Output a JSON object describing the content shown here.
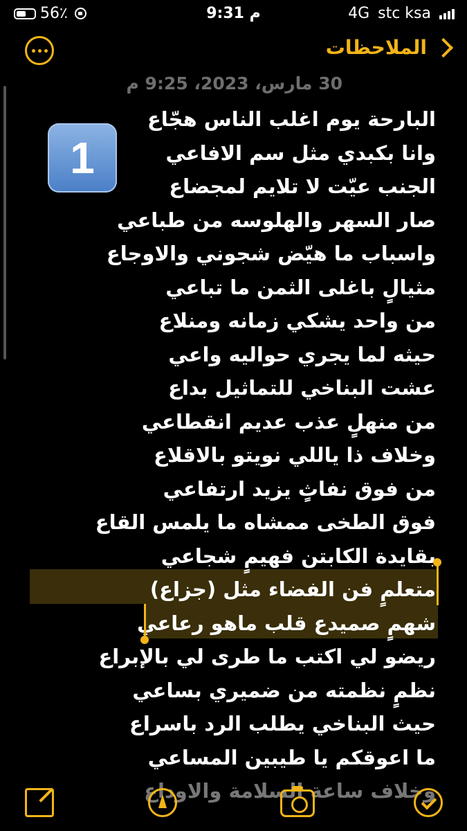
{
  "status_bar": {
    "battery": "56٪",
    "battery_level": 0.56,
    "time": "9:31 م",
    "network": "4G",
    "carrier": "stc ksa"
  },
  "nav": {
    "back_label": "الملاحظات"
  },
  "note": {
    "date": "30 مارس، 2023، 9:25 م",
    "badge": "1",
    "lines": [
      "البارحة يوم اغلب الناس هجّاع",
      "وانا بكبدي مثل سم الافاعي",
      "الجنب عيّت لا تلايم لمجضاع",
      "صار السهر والهلوسه من طباعي",
      "واسباب ما هيّض شجوني والاوجاع",
      "مثيالٍ باغلى الثمن ما تباعي",
      "من واحد يشكي زمانه ومنلاع",
      "حيثه لما يجري حواليه واعي",
      "عشت البناخي للتماثيل بداع",
      "من منهلٍ عذب عديم انقطاعي",
      "وخلاف ذا ياللي نويتو بالاقلاع",
      "من فوق نفاثٍ يزيد ارتفاعي",
      "فوق الطخى ممشاه ما يلمس القاع",
      "بقايدة الكابتن فهيمٍ شجاعي",
      "متعلمٍ فن الفضاء مثل (جزاع)",
      "شهمٍ صميدع قلب ماهو رعاعي",
      "ريضو لي اكتب ما طرى لي بالإبراع",
      "نظمٍ نظمته من ضميري بساعي",
      "حيث البناخي يطلب الرد باسراع",
      "ما اعوقكم يا طيبين المساعي",
      "وخلاف ساعة السلامة والاوداع"
    ]
  }
}
